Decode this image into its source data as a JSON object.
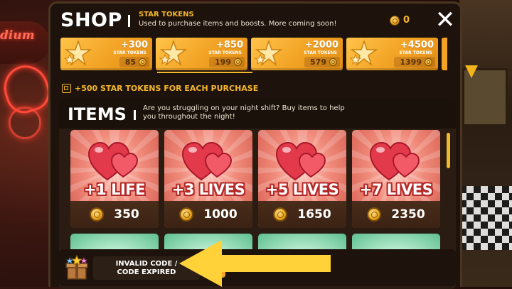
{
  "background": {
    "sign_text": "dium"
  },
  "shop": {
    "title": "SHOP",
    "close_label": "✕",
    "balance": "0",
    "tokens_heading": "STAR TOKENS",
    "tokens_description": "Used to purchase items and boosts. More coming soon!",
    "packs": [
      {
        "amount": "+300",
        "label": "STAR TOKENS",
        "price": "85"
      },
      {
        "amount": "+850",
        "label": "STAR TOKENS",
        "price": "199"
      },
      {
        "amount": "+2000",
        "label": "STAR TOKENS",
        "price": "579"
      },
      {
        "amount": "+4500",
        "label": "STAR TOKENS",
        "price": "1399"
      }
    ],
    "bonus_text": "+500 STAR TOKENS FOR EACH PURCHASE",
    "items_title": "ITEMS",
    "items_description": "Are you struggling on your night shift? Buy items to help you throughout the night!",
    "items": [
      {
        "name": "+1 LIFE",
        "price": "350"
      },
      {
        "name": "+3 LIVES",
        "price": "1000"
      },
      {
        "name": "+5 LIVES",
        "price": "1650"
      },
      {
        "name": "+7 LIVES",
        "price": "2350"
      }
    ],
    "code_bar": {
      "status_line1": "INVALID CODE /",
      "status_line2": "CODE EXPIRED"
    }
  },
  "colors": {
    "accent": "#f5b72a",
    "pack": "#f2a224",
    "item_name_stroke": "#b42a28",
    "arrow": "#ffd23a"
  }
}
